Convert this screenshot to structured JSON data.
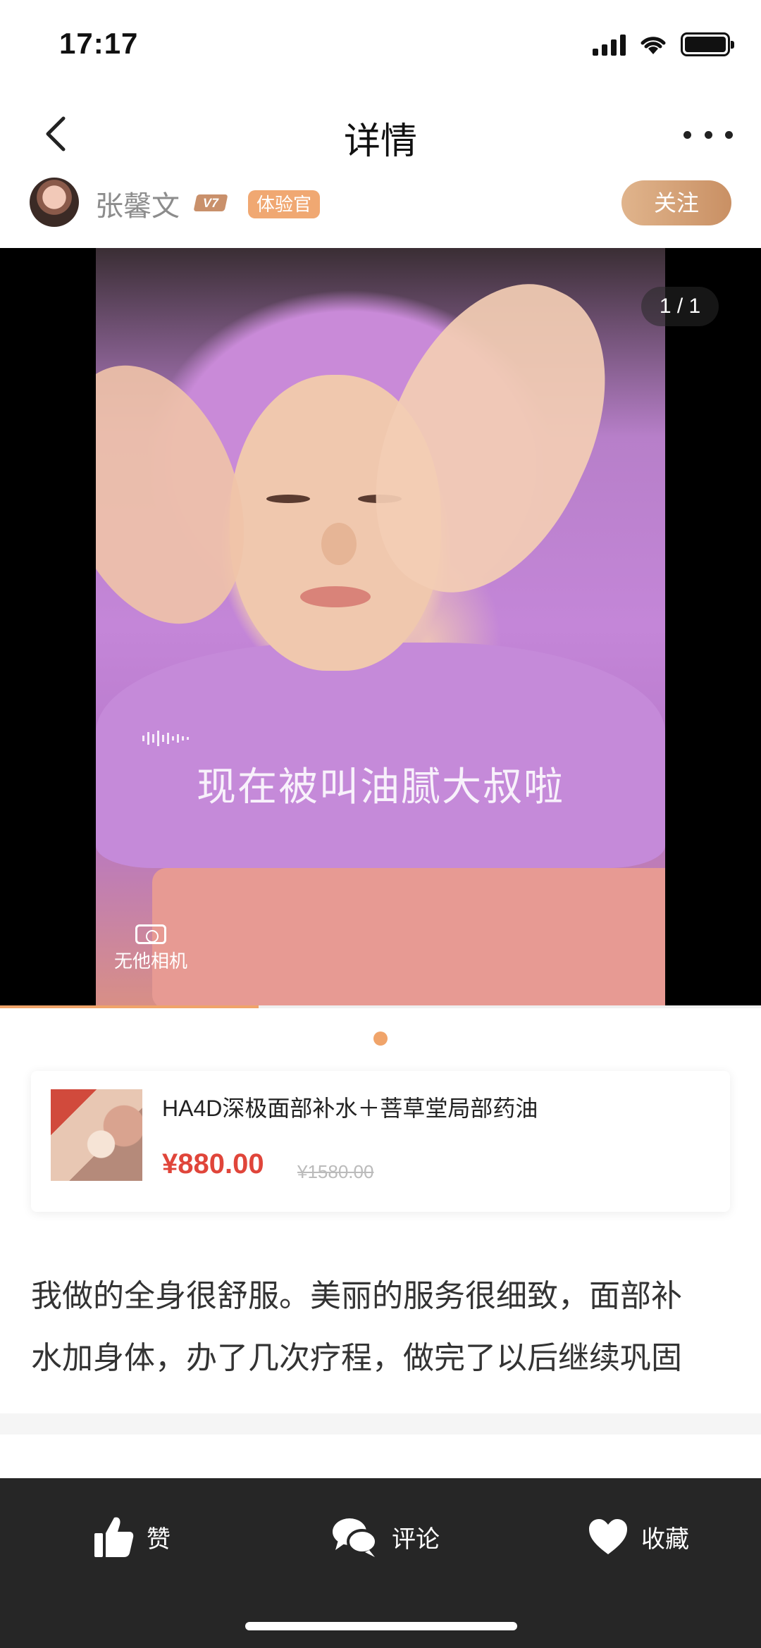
{
  "status_bar": {
    "time": "17:17"
  },
  "nav": {
    "title": "详情"
  },
  "author": {
    "name": "张馨文",
    "level": "V7",
    "role": "体验官",
    "follow_label": "关注"
  },
  "media": {
    "caption": "现在被叫油腻大叔啦",
    "watermark": "无他相机",
    "page_counter": "1 / 1",
    "progress": 0.34
  },
  "product": {
    "title": "HA4D深极面部补水＋菩草堂局部药油",
    "price": "¥880.00",
    "original_price": "¥1580.00"
  },
  "post": {
    "lines": [
      "我做的全身很舒服。美丽的服务很细致，面部补",
      "水加身体，办了几次疗程，做完了以后继续巩固"
    ]
  },
  "actions": {
    "like": "赞",
    "comment": "评论",
    "collect": "收藏"
  },
  "colors": {
    "accent": "#f0a46a",
    "price": "#e0453a",
    "bottom_bar": "#262626",
    "follow": "#d6a47a"
  }
}
